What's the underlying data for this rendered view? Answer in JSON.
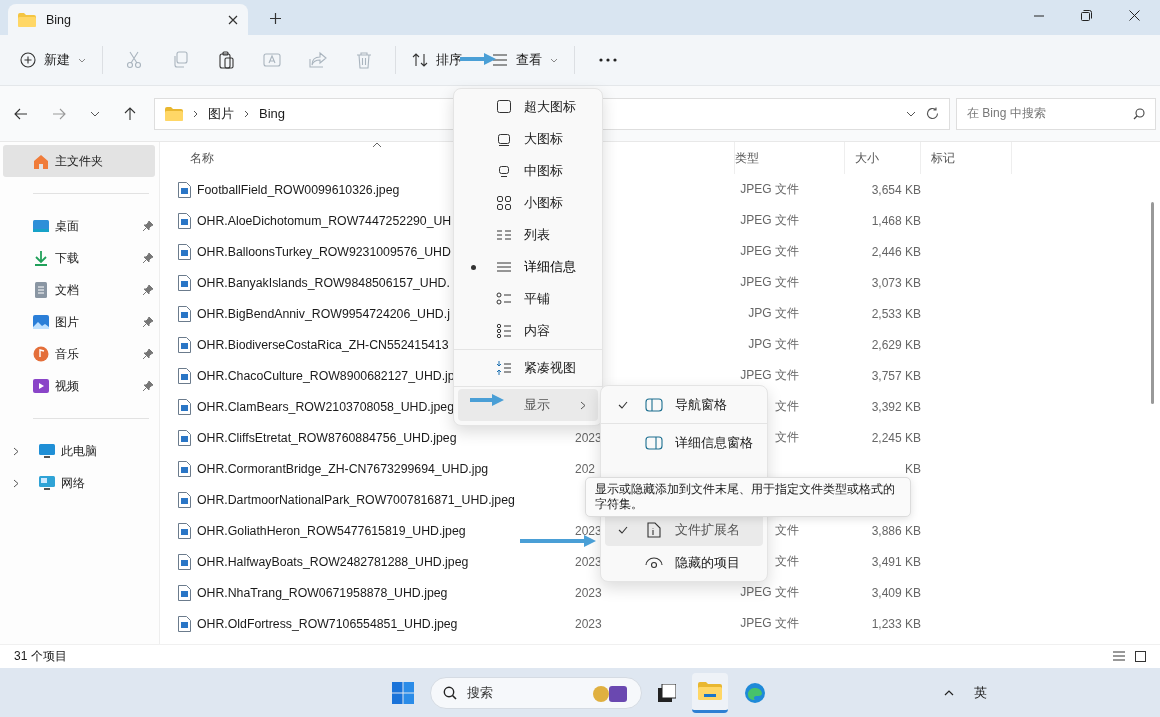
{
  "window": {
    "tab_title": "Bing"
  },
  "toolbar": {
    "new_label": "新建",
    "actions": [
      {
        "disabled": true
      },
      {
        "disabled": true
      },
      {
        "disabled": false
      },
      {
        "disabled": true
      },
      {
        "disabled": true
      },
      {
        "disabled": true
      }
    ],
    "sort_label": "排序",
    "view_label": "查看"
  },
  "address": {
    "crumbs": [
      "图片",
      "Bing"
    ],
    "search_placeholder": "在 Bing 中搜索"
  },
  "sidebar": {
    "home": {
      "label": "主文件夹",
      "selected": true
    },
    "quick": [
      {
        "label": "桌面"
      },
      {
        "label": "下载"
      },
      {
        "label": "文档"
      },
      {
        "label": "图片"
      },
      {
        "label": "音乐"
      },
      {
        "label": "视频"
      }
    ],
    "drives": [
      {
        "label": "此电脑"
      },
      {
        "label": "网络"
      }
    ]
  },
  "columns": {
    "name": "名称",
    "type": "类型",
    "size": "大小",
    "tag": "标记"
  },
  "files": [
    {
      "name": "FootballField_ROW0099610326.jpeg",
      "type": "JPEG 文件",
      "size": "3,654 KB"
    },
    {
      "name": "OHR.AloeDichotomum_ROW7447252290_UH",
      "type": "JPEG 文件",
      "size": "1,468 KB"
    },
    {
      "name": "OHR.BalloonsTurkey_ROW9231009576_UHD",
      "type": "JPEG 文件",
      "size": "2,446 KB"
    },
    {
      "name": "OHR.BanyakIslands_ROW9848506157_UHD.",
      "type": "JPEG 文件",
      "size": "3,073 KB"
    },
    {
      "name": "OHR.BigBendAnniv_ROW9954724206_UHD.j",
      "type": "JPG 文件",
      "size": "2,533 KB"
    },
    {
      "name": "OHR.BiodiverseCostaRica_ZH-CN552415413",
      "type": "JPG 文件",
      "size": "2,629 KB"
    },
    {
      "name": "OHR.ChacoCulture_ROW8900682127_UHD.jp",
      "type": "JPEG 文件",
      "size": "3,757 KB"
    },
    {
      "name": "OHR.ClamBears_ROW2103708058_UHD.jpeg",
      "type": "文件",
      "size": "3,392 KB"
    },
    {
      "name": "OHR.CliffsEtretat_ROW8760884756_UHD.jpeg",
      "date": "2023",
      "type": "文件",
      "size": "2,245 KB"
    },
    {
      "name": "OHR.CormorantBridge_ZH-CN7673299694_UHD.jpg",
      "date": "202",
      "size": "KB"
    },
    {
      "name": "OHR.DartmoorNationalPark_ROW7007816871_UHD.jpeg"
    },
    {
      "name": "OHR.GoliathHeron_ROW5477615819_UHD.jpeg",
      "date": "2023",
      "type": "文件",
      "size": "3,886 KB"
    },
    {
      "name": "OHR.HalfwayBoats_ROW2482781288_UHD.jpeg",
      "date": "2023",
      "type": "文件",
      "size": "3,491 KB"
    },
    {
      "name": "OHR.NhaTrang_ROW0671958878_UHD.jpeg",
      "date": "2023",
      "type": "JPEG 文件",
      "size": "3,409 KB"
    },
    {
      "name": "OHR.OldFortress_ROW7106554851_UHD.jpeg",
      "date": "2023",
      "type": "JPEG 文件",
      "size": "1,233 KB"
    }
  ],
  "status_bar": {
    "count": "31 个项目"
  },
  "view_menu": {
    "items": [
      {
        "kind": "view",
        "label": "超大图标",
        "selected": false
      },
      {
        "kind": "view",
        "label": "大图标",
        "selected": false
      },
      {
        "kind": "view",
        "label": "中图标",
        "selected": false
      },
      {
        "kind": "view",
        "label": "小图标",
        "selected": false
      },
      {
        "kind": "view",
        "label": "列表",
        "selected": false
      },
      {
        "kind": "view",
        "label": "详细信息",
        "selected": true
      },
      {
        "kind": "view",
        "label": "平铺",
        "selected": false
      },
      {
        "kind": "view",
        "label": "内容",
        "selected": false
      },
      {
        "kind": "toggle",
        "label": "紧凑视图"
      },
      {
        "kind": "submenu",
        "label": "显示",
        "highlighted": true
      }
    ]
  },
  "show_submenu": {
    "items": [
      {
        "label": "导航窗格",
        "checked": true,
        "highlighted": false
      },
      {
        "label": "详细信息窗格",
        "checked": false,
        "highlighted": false
      },
      {
        "label": "文件扩展名",
        "checked": true,
        "highlighted": true
      },
      {
        "label": "隐藏的项目",
        "checked": false,
        "highlighted": false
      }
    ]
  },
  "tooltip": "显示或隐藏添加到文件末尾、用于指定文件类型或格式的字符集。",
  "taskbar": {
    "search_placeholder": "搜索",
    "input_method": "英"
  }
}
